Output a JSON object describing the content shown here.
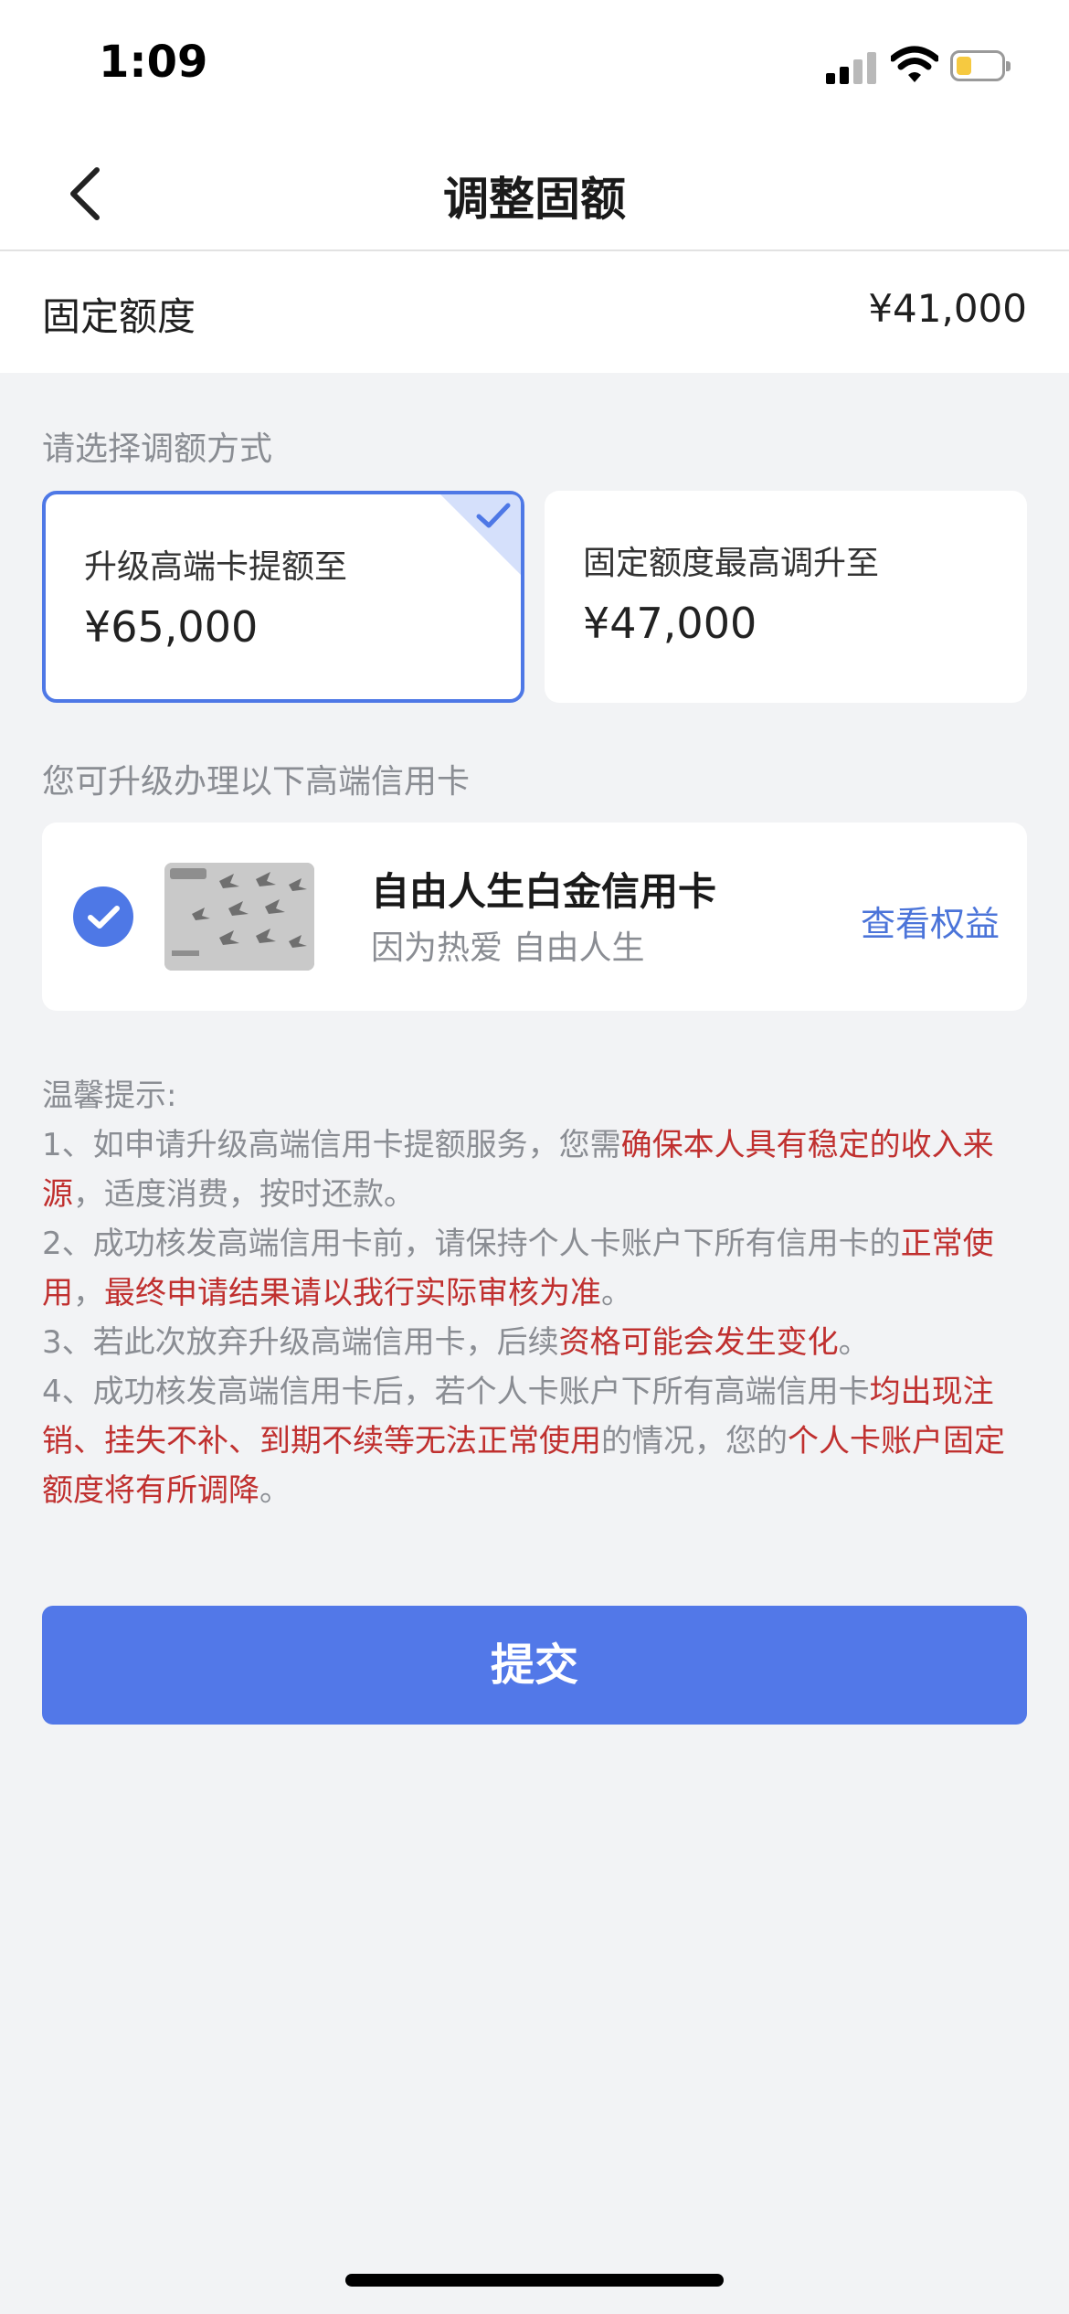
{
  "status_bar": {
    "time": "1:09"
  },
  "navbar": {
    "title": "调整固额"
  },
  "fixed_limit": {
    "label": "固定额度",
    "value": "¥41,000"
  },
  "choose_method": {
    "label": "请选择调额方式"
  },
  "options": [
    {
      "title": "升级高端卡提额至",
      "amount": "¥65,000",
      "selected": true
    },
    {
      "title": "固定额度最高调升至",
      "amount": "¥47,000",
      "selected": false
    }
  ],
  "upgrade_section": {
    "label": "您可升级办理以下高端信用卡"
  },
  "card": {
    "name": "自由人生白金信用卡",
    "subtitle": "因为热爱 自由人生",
    "link_label": "查看权益",
    "selected": true
  },
  "tips": {
    "title": "温馨提示:",
    "t1_a": "1、如申请升级高端信用卡提额服务，您需",
    "t1_b": "确保本人具有稳定的收入来源",
    "t1_c": "，适度消费，按时还款。",
    "t2_a": "2、成功核发高端信用卡前，请保持个人卡账户下所有信用卡的",
    "t2_b": "正常使用",
    "t2_c": "，",
    "t2_d": "最终申请结果请以我行实际审核为准",
    "t2_e": "。",
    "t3_a": "3、若此次放弃升级高端信用卡，后续",
    "t3_b": "资格可能会发生变化",
    "t3_c": "。",
    "t4_a": "4、成功核发高端信用卡后，若个人卡账户下所有高端信用卡",
    "t4_b": "均出现注销、挂失不补、到期不续等无法正常使用",
    "t4_c": "的情况，您的",
    "t4_d": "个人卡账户固定额度将有所调降",
    "t4_e": "。"
  },
  "submit": {
    "label": "提交"
  },
  "colors": {
    "accent": "#5278e8",
    "warning_text": "#c0302f",
    "muted_text": "#8a8d93"
  }
}
